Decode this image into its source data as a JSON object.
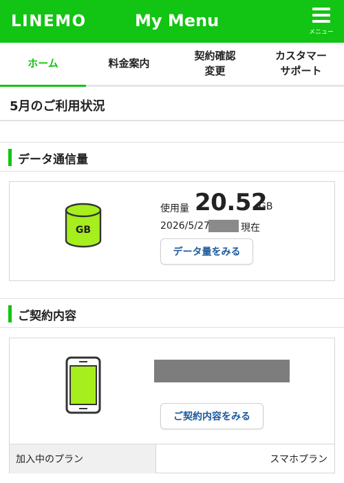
{
  "header": {
    "logo": "LINEMO",
    "title": "My Menu",
    "menu_label": "メニュー"
  },
  "tabs": [
    {
      "label": "ホーム",
      "active": true
    },
    {
      "label": "料金案内"
    },
    {
      "label": "契約確認\n変更"
    },
    {
      "label": "カスタマー\nサポート"
    }
  ],
  "usage_header": "5月のご利用状況",
  "data_section": {
    "title": "データ通信量",
    "icon_label": "GB",
    "usage_label": "使用量",
    "usage_value": "20.52",
    "usage_unit": "GB",
    "date": "2026/5/27",
    "as_of": "現在",
    "button": "データ量をみる"
  },
  "contract_section": {
    "title": "ご契約内容",
    "button": "ご契約内容をみる",
    "plan_label": "加入中のプラン",
    "plan_value": "スマホプラン"
  },
  "colors": {
    "brand_green": "#12c413",
    "icon_fill": "#a6ee1d",
    "link_blue": "#1c5a9c"
  }
}
